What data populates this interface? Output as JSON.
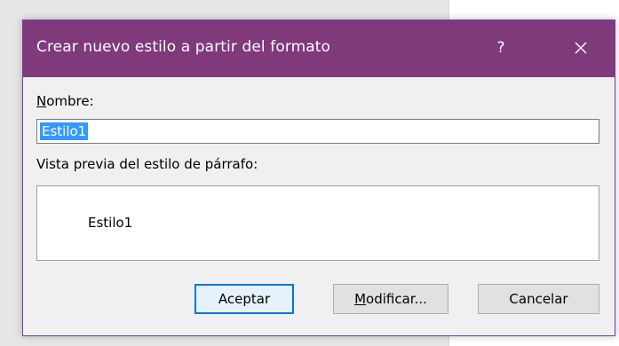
{
  "dialog": {
    "title": "Crear nuevo estilo a partir del formato",
    "help_label": "?",
    "close_icon": "close-icon",
    "name_label_first": "N",
    "name_label_rest": "ombre:",
    "name_value": "Estilo1",
    "preview_label": "Vista previa del estilo de párrafo:",
    "preview_text": "Estilo1",
    "ok_label": "Aceptar",
    "modify_label_first": "M",
    "modify_label_rest": "odificar...",
    "cancel_label": "Cancelar"
  },
  "colors": {
    "titlebar": "#80397b",
    "selection": "#3399ff",
    "default_button_border": "#0078d7"
  }
}
